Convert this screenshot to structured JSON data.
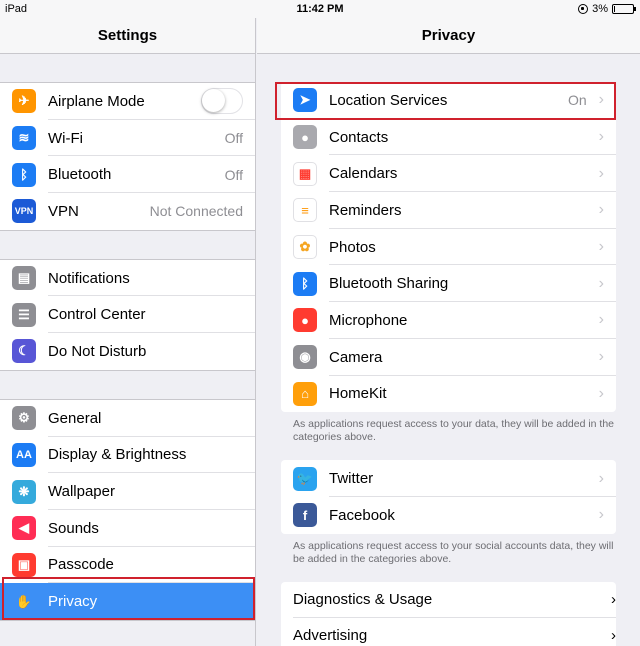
{
  "status": {
    "device": "iPad",
    "time": "11:42 PM",
    "battery": "3%",
    "battery_level": 0.03
  },
  "left": {
    "title": "Settings",
    "groups": [
      [
        {
          "label": "Airplane Mode",
          "icon": "airplane-icon",
          "color": "#ff9500",
          "toggle": "off"
        },
        {
          "label": "Wi-Fi",
          "value": "Off",
          "icon": "wifi-icon",
          "color": "#1c7cf4"
        },
        {
          "label": "Bluetooth",
          "value": "Off",
          "icon": "bluetooth-icon",
          "color": "#1c7cf4"
        },
        {
          "label": "VPN",
          "value": "Not Connected",
          "icon": "vpn-icon",
          "color": "#1c5ad6",
          "icon_text": "VPN"
        }
      ],
      [
        {
          "label": "Notifications",
          "icon": "notifications-icon",
          "color": "#8e8e93"
        },
        {
          "label": "Control Center",
          "icon": "control-center-icon",
          "color": "#8e8e93"
        },
        {
          "label": "Do Not Disturb",
          "icon": "moon-icon",
          "color": "#5856d6"
        }
      ],
      [
        {
          "label": "General",
          "icon": "gear-icon",
          "color": "#8e8e93"
        },
        {
          "label": "Display & Brightness",
          "icon": "display-icon",
          "color": "#1c7cf4",
          "icon_text": "AA"
        },
        {
          "label": "Wallpaper",
          "icon": "wallpaper-icon",
          "color": "#35aadc"
        },
        {
          "label": "Sounds",
          "icon": "speaker-icon",
          "color": "#ff2d55"
        },
        {
          "label": "Passcode",
          "icon": "lock-icon",
          "color": "#ff3b30"
        },
        {
          "label": "Privacy",
          "icon": "hand-icon",
          "color": "#3c8ff5",
          "selected": true
        }
      ]
    ]
  },
  "right": {
    "title": "Privacy",
    "card1": [
      {
        "label": "Location Services",
        "value": "On",
        "icon": "location-arrow-icon",
        "color": "#1c7cf4"
      },
      {
        "label": "Contacts",
        "icon": "contacts-icon",
        "color": "#a9a9ae"
      },
      {
        "label": "Calendars",
        "icon": "calendar-icon",
        "color": "#ffffff"
      },
      {
        "label": "Reminders",
        "icon": "reminders-icon",
        "color": "#ffffff"
      },
      {
        "label": "Photos",
        "icon": "photos-icon",
        "color": "#ffffff"
      },
      {
        "label": "Bluetooth Sharing",
        "icon": "bluetooth-icon",
        "color": "#1c7cf4"
      },
      {
        "label": "Microphone",
        "icon": "microphone-icon",
        "color": "#ff3b30"
      },
      {
        "label": "Camera",
        "icon": "camera-icon",
        "color": "#8e8e93"
      },
      {
        "label": "HomeKit",
        "icon": "home-icon",
        "color": "#ff9f0a"
      }
    ],
    "note1": "As applications request access to your data, they will be added in the categories above.",
    "card2": [
      {
        "label": "Twitter",
        "icon": "twitter-icon",
        "color": "#2aa3ef"
      },
      {
        "label": "Facebook",
        "icon": "facebook-icon",
        "color": "#3b5998"
      }
    ],
    "note2": "As applications request access to your social accounts data, they will be added in the categories above.",
    "card3": [
      {
        "label": "Diagnostics & Usage"
      },
      {
        "label": "Advertising"
      }
    ]
  }
}
